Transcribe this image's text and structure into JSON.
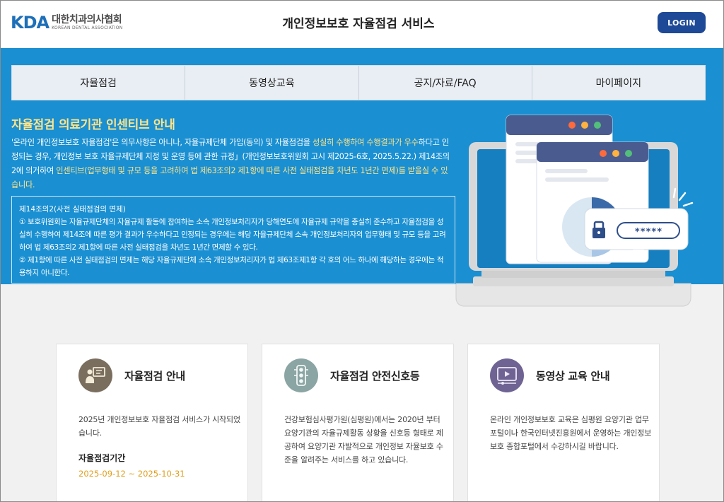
{
  "header": {
    "logo_mark": "KDA",
    "logo_korean": "대한치과의사협회",
    "logo_english": "KOREAN DENTAL ASSOCIATION",
    "site_title": "개인정보보호 자율점검 서비스",
    "login_label": "LOGIN"
  },
  "nav": {
    "items": [
      "자율점검",
      "동영상교육",
      "공지/자료/FAQ",
      "마이페이지"
    ]
  },
  "hero": {
    "title": "자율점검 의료기관 인센티브 안내",
    "desc_1": "'온라인 개인정보보호 자율점검'은 의무사항은 아니나, 자율규제단체 가입(동의) 및 자율점검을 ",
    "desc_hl_1": "성실히 수행하여 수행결과가 우수",
    "desc_2": "하다고 인정되는 경우, 개인정보 보호 자율규제단체 지정 및 운영 등에 관한 규정」(개인정보보호위원회 고시 제2025-6호, 2025.5.22.) 제14조의 2에 의거하여 ",
    "desc_hl_2": "인센티브(업무형태 및 규모 등을 고려하여 법 제63조의2 제1항에 따른 사전 실태점검을 차년도 1년간 면제)",
    "desc_3": "를 받을실 수 있습니다.",
    "law_title": "제14조의2(사전 실태점검의 면제)",
    "law_1": "① 보호위원회는 자율규제단체의 자율규제 활동에 참여하는 소속 개인정보처리자가 당해연도에 자율규제 규약을 충실히 준수하고 자율점검을 성실히 수행하여 제14조에 따른 평가 결과가 우수하다고 인정되는 경우에는 해당 자율규제단체 소속 개인정보처리자의 업무형태 및 규모 등을 고려하여 법 제63조의2 제1항에 따른 사전 실태점검을 차년도 1년간 면제할 수 있다.",
    "law_2": "② 제1항에 따른 사전 실태점검의 면제는 해당 자율규제단체 소속 개인정보처리자가 법 제63조제1항 각 호의 어느 하나에 해당하는 경우에는 적용하지 아니한다.",
    "password_mask": "*****"
  },
  "cards": [
    {
      "title": "자율점검 안내",
      "icon": "person-presentation-icon",
      "icon_color": "#7a6e5f",
      "text": "2025년 개인정보보호 자율점검 서비스가 시작되었습니다.",
      "sub_title": "자율점검기간",
      "period": "2025-09-12 ~ 2025-10-31"
    },
    {
      "title": "자율점검 안전신호등",
      "icon": "traffic-light-icon",
      "icon_color": "#8aa5a3",
      "text": "건강보험심사평가원(심평원)에서는 2020년 부터 요양기관의 자율규제활동 상황을 신호등 형태로 제공하여 요양기관 자발적으로 개인정보 자율보호 수준을 알려주는 서비스를 하고 있습니다."
    },
    {
      "title": "동영상 교육 안내",
      "icon": "video-player-icon",
      "icon_color": "#6f6393",
      "text": "온라인 개인정보보호 교육은 심평원 요양기관 업무포털이나 한국인터넷진흥원에서 운영하는 개인정보보호 종합포털에서 수강하시길 바랍니다."
    }
  ],
  "colors": {
    "hero_bg": "#1a8fd1",
    "highlight": "#ffe48a",
    "login_bg": "#1e4996",
    "period": "#e09e1a"
  }
}
